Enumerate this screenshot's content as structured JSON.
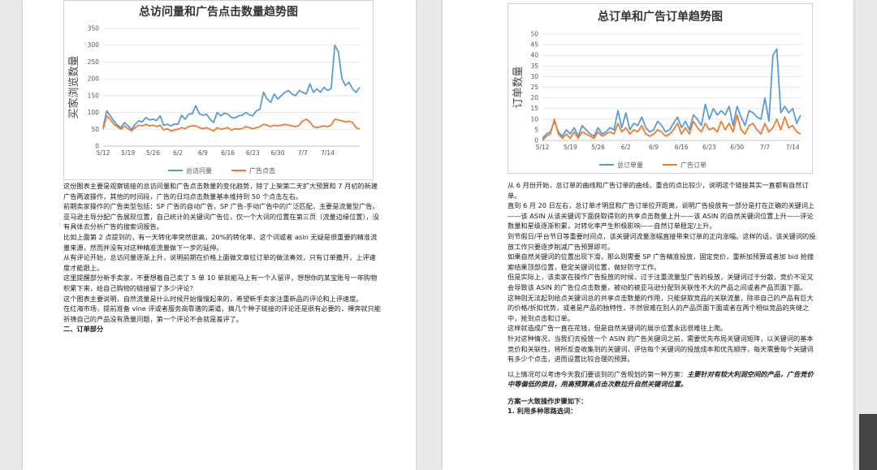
{
  "left_page": {
    "chart_data": {
      "type": "line",
      "title": "总访问量和广告点击数量趋势图",
      "ylabel": "买家浏览数量",
      "ylim": [
        0,
        350
      ],
      "yticks": [
        "0",
        "50",
        "100",
        "150",
        "200",
        "250",
        "300",
        "350"
      ],
      "x_tick_labels": [
        "5/12",
        "5/19",
        "5/26",
        "6/2",
        "6/9",
        "6/16",
        "6/23",
        "6/30",
        "7/7",
        "7/14"
      ],
      "grid": true,
      "legend_position": "bottom",
      "series": [
        {
          "name": "总访问量",
          "color": "#5b9bd5",
          "values": [
            55,
            105,
            90,
            75,
            62,
            55,
            70,
            60,
            50,
            65,
            75,
            72,
            85,
            78,
            80,
            76,
            90,
            62,
            65,
            60,
            66,
            65,
            92,
            80,
            95,
            96,
            120,
            96,
            92,
            95,
            80,
            70,
            100,
            90,
            98,
            95,
            85,
            84,
            90,
            92,
            100,
            94,
            90,
            105,
            110,
            160,
            140,
            130,
            155,
            140,
            150,
            160,
            165,
            155,
            150,
            165,
            160,
            155,
            185,
            160,
            170,
            160,
            175,
            165,
            172,
            300,
            280,
            200,
            180,
            190,
            170,
            160,
            175
          ]
        },
        {
          "name": "广告点击",
          "color": "#ed7d31",
          "values": [
            50,
            90,
            80,
            65,
            58,
            50,
            60,
            52,
            45,
            55,
            62,
            60,
            65,
            60,
            62,
            58,
            62,
            48,
            52,
            45,
            48,
            50,
            55,
            52,
            58,
            60,
            60,
            55,
            52,
            55,
            50,
            45,
            55,
            50,
            52,
            55,
            48,
            52,
            50,
            52,
            58,
            55,
            52,
            55,
            58,
            65,
            62,
            58,
            62,
            60,
            62,
            65,
            62,
            60,
            58,
            62,
            75,
            80,
            72,
            58,
            55,
            58,
            60,
            58,
            62,
            80,
            78,
            75,
            72,
            74,
            70,
            55,
            50
          ]
        }
      ]
    },
    "paragraphs": [
      "这份图表主要是观察链接的总访问量和广告点击数量的变化趋势，除了上架第二天扩大预算和 7 月初的新建广告两波操作，其他的时间段，广告的日均点击数量基本维持到 50 个点击左右。",
      "前期卖家操作的广告类型包括：SP 广告的自动广告，SP 广告-手动广告中的广泛匹配，主要是流量型广告。亚马逊主导分配广告展现位置，自己统计的关键词广告位，仅一个大词的位置在第三页（流量边缘位置），没有具体去分析广告的搜索词报告。",
      "比如上面第 2 点提到的，有一天转化率突然很高，20%的转化率，这个词或者 asin 无疑是很重要的精准流量来源，然而并没有对这种精准流量做下一步的延伸。",
      "从有评论开始，总访问量逐渐上升，说明前期在价格上面做文章拉订单的做法奏效，只有订单撒开，上评速度才能跟上。",
      "这里提醒部分新手卖家，不要想着自己卖了 5 单 10 单就能马上有一个人留评，想想你的某宝账号一年购物积累下来，给自己购物的链接留了多少评论？",
      "这个图表主要说明，自然流量是什么时候开始慢慢起来的，希望新手卖家注重新品的评论和上评速度。",
      "在红海市场，提前准备 vine 评或者服务商靠谱的渠道，搞几个种子链接的评论还是很有必要的，裸奔就只能祈祷自己的产品没有质量问题，第一个评论不会就是差评了。"
    ],
    "section_heading": "二、订单部分"
  },
  "right_page": {
    "chart_data": {
      "type": "line",
      "title": "总订单和广告订单趋势图",
      "ylabel": "订单数量",
      "ylim": [
        0,
        50
      ],
      "yticks": [
        "0",
        "5",
        "10",
        "15",
        "20",
        "25",
        "30",
        "35",
        "40",
        "45",
        "50"
      ],
      "x_tick_labels": [
        "5/12",
        "5/19",
        "5/26",
        "6/2",
        "6/9",
        "6/16",
        "6/23",
        "6/30",
        "7/7",
        "7/14"
      ],
      "grid": true,
      "legend_position": "bottom",
      "series": [
        {
          "name": "总订单量",
          "color": "#5b9bd5",
          "values": [
            1,
            3,
            4,
            9,
            4,
            2,
            5,
            3,
            6,
            2,
            7,
            5,
            3,
            2,
            6,
            3,
            4,
            6,
            5,
            14,
            6,
            13,
            5,
            8,
            7,
            11,
            6,
            4,
            5,
            9,
            7,
            4,
            5,
            8,
            11,
            6,
            9,
            5,
            12,
            10,
            7,
            17,
            10,
            15,
            12,
            14,
            12,
            16,
            7,
            16,
            11,
            7,
            14,
            13,
            11,
            10,
            20,
            9,
            40,
            43,
            13,
            16,
            13,
            15,
            8,
            12
          ]
        },
        {
          "name": "广告订单",
          "color": "#ed7d31",
          "values": [
            0,
            2,
            3,
            10,
            3,
            1,
            3,
            1,
            4,
            1,
            4,
            3,
            2,
            1,
            4,
            2,
            3,
            4,
            3,
            8,
            4,
            6,
            3,
            5,
            4,
            7,
            3,
            2,
            3,
            5,
            4,
            2,
            3,
            5,
            8,
            3,
            6,
            3,
            9,
            6,
            4,
            8,
            5,
            6,
            4,
            9,
            5,
            8,
            4,
            12,
            5,
            3,
            7,
            8,
            5,
            3,
            8,
            4,
            6,
            10,
            5,
            11,
            6,
            7,
            4,
            3
          ]
        }
      ]
    },
    "paragraphs": [
      "从 6 月份开始，总订单的曲线和广告订单的曲线，重合的点比较少，说明这个链接其实一直都有自然订单。",
      "直到 6 月 20 日左右，总订单才明显和广告订单拉开距离，说明广告投放有一部分是打在正确的关键词上——该 ASIN 从该关键词下面获取得到的共享点击数量上升——该 ASIN 的自然关键词位置上升——评论数量和星级逐渐积累，对转化率产生积极影响——自然订单稳定/上升。",
      "到节假日/平台节日等重要时间点，该关键词流量涨幅直接带来订单的正向涨幅。这样的话，该关键词的投放工作只要逐步削减广告预算即可。",
      "如果自然关键词的位置出现下滑，那么则需要 SP 广告精准投放，固定竞价，重新加预算或者加 bid 抢搜索结果顶部位置，稳定关键词位置，做好防守工作。",
      "但是实际上，该卖家在操作广告投放的时候，过于注重流量型广告的投放，关键词过于分散，竞价不足又会导致该 ASIN 的广告位点击数量，被动的被亚马逊分配到关联性不大的产品之间或者产品页面下面。",
      "这种则无法起到给点关键词总的共享点击数量的作用，只能获取竞品的关联流量，除非自己的产品有巨大的价格/折扣优势，或者是产品的独特性，不然很难在别人的产品页面下面或者在两个相似竞品的夹缝之中，抢到点击和订单。",
      "这样就造成广告一直在花钱，但是自然关键词的展示位置永远很难往上爬。",
      "针对这种情况，当我们去投放一个 ASIN 的广告关键词之前，需要优先布局关键词矩阵，以关键词的基本竞价和关联性，将所反查收集到的关键词，评估每个关键词的投放成本和优先顺序，每天需要每个关键词有多少个点击，进而设置比较合理的预算。"
    ],
    "plan_intro": "以上情况可以考虑今天我们要谈到的广告规划的第一种方案：",
    "plan_emphasis": "主要针对有较大利润空间的产品，广告竞价中等偏低的类目，用高预算高点击次数拉升自然关键词位置。",
    "steps_heading": "方案一大致操作步骤如下：",
    "step1": "1. 利用多种思路选词："
  }
}
